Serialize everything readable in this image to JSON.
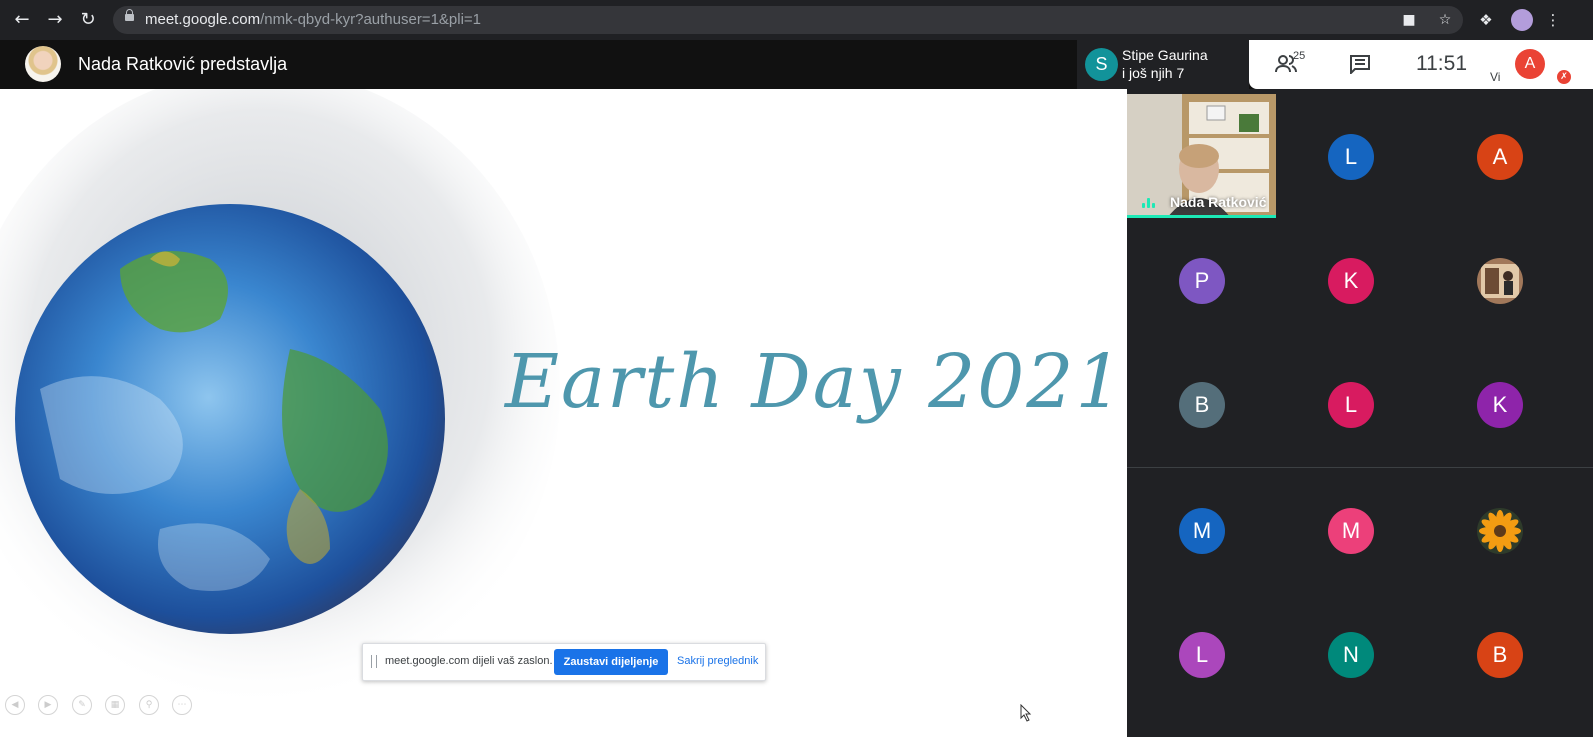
{
  "browser": {
    "url_host": "meet.google.com",
    "url_path": "/nmk-qbyd-kyr?authuser=1&pli=1"
  },
  "header": {
    "presenter_title": "Nada Ratković predstavlja",
    "rail_name": "Stipe Gaurina",
    "rail_more": "i još njih 7",
    "rail_initial": "S"
  },
  "toolbar": {
    "participant_count": "25",
    "time": "11:51",
    "self_initial": "A",
    "self_label": "Vi"
  },
  "slide": {
    "title": "Earth Day 2021"
  },
  "share_bar": {
    "message": "meet.google.com dijeli vaš zaslon.",
    "stop_label": "Zaustavi dijeljenje",
    "hide_label": "Sakrij preglednik"
  },
  "participants": {
    "featured_name": "Nada Ratković",
    "tiles": [
      {
        "initial": "L",
        "color": "#1565c0"
      },
      {
        "initial": "A",
        "color": "#d84315"
      },
      {
        "initial": "P",
        "color": "#7e57c2"
      },
      {
        "initial": "K",
        "color": "#d81b60"
      },
      {
        "initial": "",
        "color": "#8d6e63",
        "photo": "person-photo"
      },
      {
        "initial": "B",
        "color": "#546e7a"
      },
      {
        "initial": "L",
        "color": "#d81b60"
      },
      {
        "initial": "K",
        "color": "#8e24aa"
      },
      {
        "initial": "M",
        "color": "#1565c0"
      },
      {
        "initial": "M",
        "color": "#ec407a"
      },
      {
        "initial": "",
        "color": "#ef6c00",
        "photo": "flower-photo"
      },
      {
        "initial": "L",
        "color": "#ab47bc"
      },
      {
        "initial": "N",
        "color": "#00897b"
      },
      {
        "initial": "B",
        "color": "#d84315"
      }
    ]
  }
}
